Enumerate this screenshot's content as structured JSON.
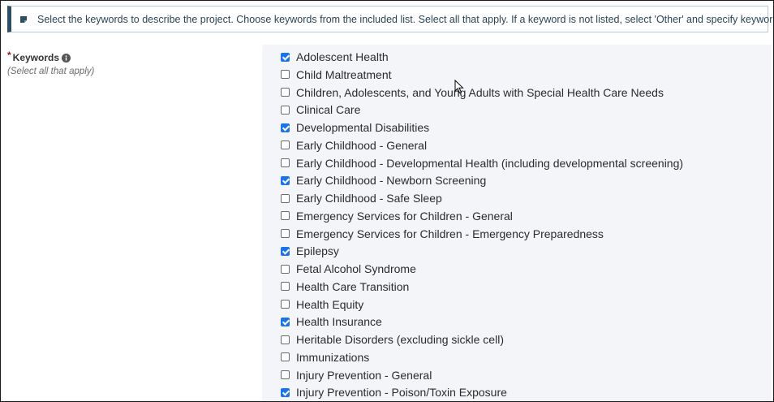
{
  "instruction": {
    "text": "Select the keywords to describe the project. Choose keywords from the included list. Select all that apply. If a keyword is not listed, select 'Other' and specify keyword(s)."
  },
  "field": {
    "required_marker": "*",
    "label": "Keywords",
    "hint": "(Select all that apply)"
  },
  "keywords": [
    {
      "label": "Adolescent Health",
      "checked": true
    },
    {
      "label": "Child Maltreatment",
      "checked": false
    },
    {
      "label": "Children, Adolescents, and Young Adults with Special Health Care Needs",
      "checked": false
    },
    {
      "label": "Clinical Care",
      "checked": false
    },
    {
      "label": "Developmental Disabilities",
      "checked": true
    },
    {
      "label": "Early Childhood - General",
      "checked": false
    },
    {
      "label": "Early Childhood - Developmental Health (including developmental screening)",
      "checked": false
    },
    {
      "label": "Early Childhood - Newborn Screening",
      "checked": true
    },
    {
      "label": "Early Childhood - Safe Sleep",
      "checked": false
    },
    {
      "label": "Emergency Services for Children - General",
      "checked": false
    },
    {
      "label": "Emergency Services for Children - Emergency Preparedness",
      "checked": false
    },
    {
      "label": "Epilepsy",
      "checked": true
    },
    {
      "label": "Fetal Alcohol Syndrome",
      "checked": false
    },
    {
      "label": "Health Care Transition",
      "checked": false
    },
    {
      "label": "Health Equity",
      "checked": false
    },
    {
      "label": "Health Insurance",
      "checked": true
    },
    {
      "label": "Heritable Disorders (excluding sickle cell)",
      "checked": false
    },
    {
      "label": "Immunizations",
      "checked": false
    },
    {
      "label": "Injury Prevention - General",
      "checked": false
    },
    {
      "label": "Injury Prevention - Poison/Toxin Exposure",
      "checked": true
    }
  ],
  "colors": {
    "accent": "#1a73e8",
    "instruction_border": "#2d4d63",
    "panel_background": "#f3f5f8"
  },
  "icons": {
    "instruction": "note-icon",
    "label_info": "info-icon",
    "pointer": "mouse-cursor-icon"
  }
}
